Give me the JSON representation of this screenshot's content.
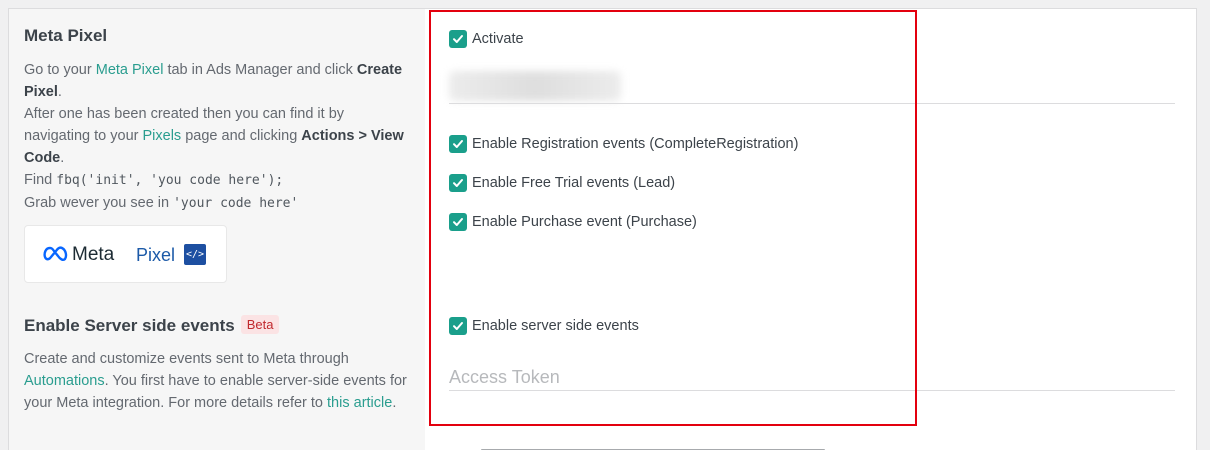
{
  "meta_pixel": {
    "title": "Meta Pixel",
    "desc": {
      "go_to": "Go to your ",
      "link_meta_pixel": "Meta Pixel",
      "tab_text": " tab in Ads Manager and click ",
      "create_pixel": "Create Pixel",
      "period1": ".",
      "after_text": "After one has been created then you can find it by navigating to your ",
      "link_pixels": "Pixels",
      "page_clicking": " page and clicking ",
      "actions_view": "Actions > View Code",
      "period2": ".",
      "find": "Find ",
      "find_code": "fbq('init', 'you code here');",
      "grab": "Grab wever you see in ",
      "grab_code": "'your code here'"
    },
    "logo": {
      "meta_text": "Meta",
      "pixel_text": "Pixel",
      "code_glyph": "</>"
    }
  },
  "server_side": {
    "title": "Enable Server side events",
    "badge": "Beta",
    "desc": {
      "line1": "Create and customize events sent to Meta through ",
      "link_automations": "Automations",
      "line2": ". You first have to enable server-side events for your Meta integration. For more details refer to ",
      "link_article": "this article",
      "end": "."
    }
  },
  "form": {
    "activate_label": "Activate",
    "registration_label": "Enable Registration events (CompleteRegistration)",
    "free_trial_label": "Enable Free Trial events (Lead)",
    "purchase_label": "Enable Purchase event (Purchase)",
    "server_side_label": "Enable server side events",
    "access_token_placeholder": "Access Token",
    "access_token_value": ""
  },
  "colors": {
    "checkbox": "#1a9f8b",
    "link": "#2a9d8f",
    "highlight_border": "#e3000e",
    "beta_bg": "#fbe3e4",
    "beta_text": "#c1292e"
  }
}
